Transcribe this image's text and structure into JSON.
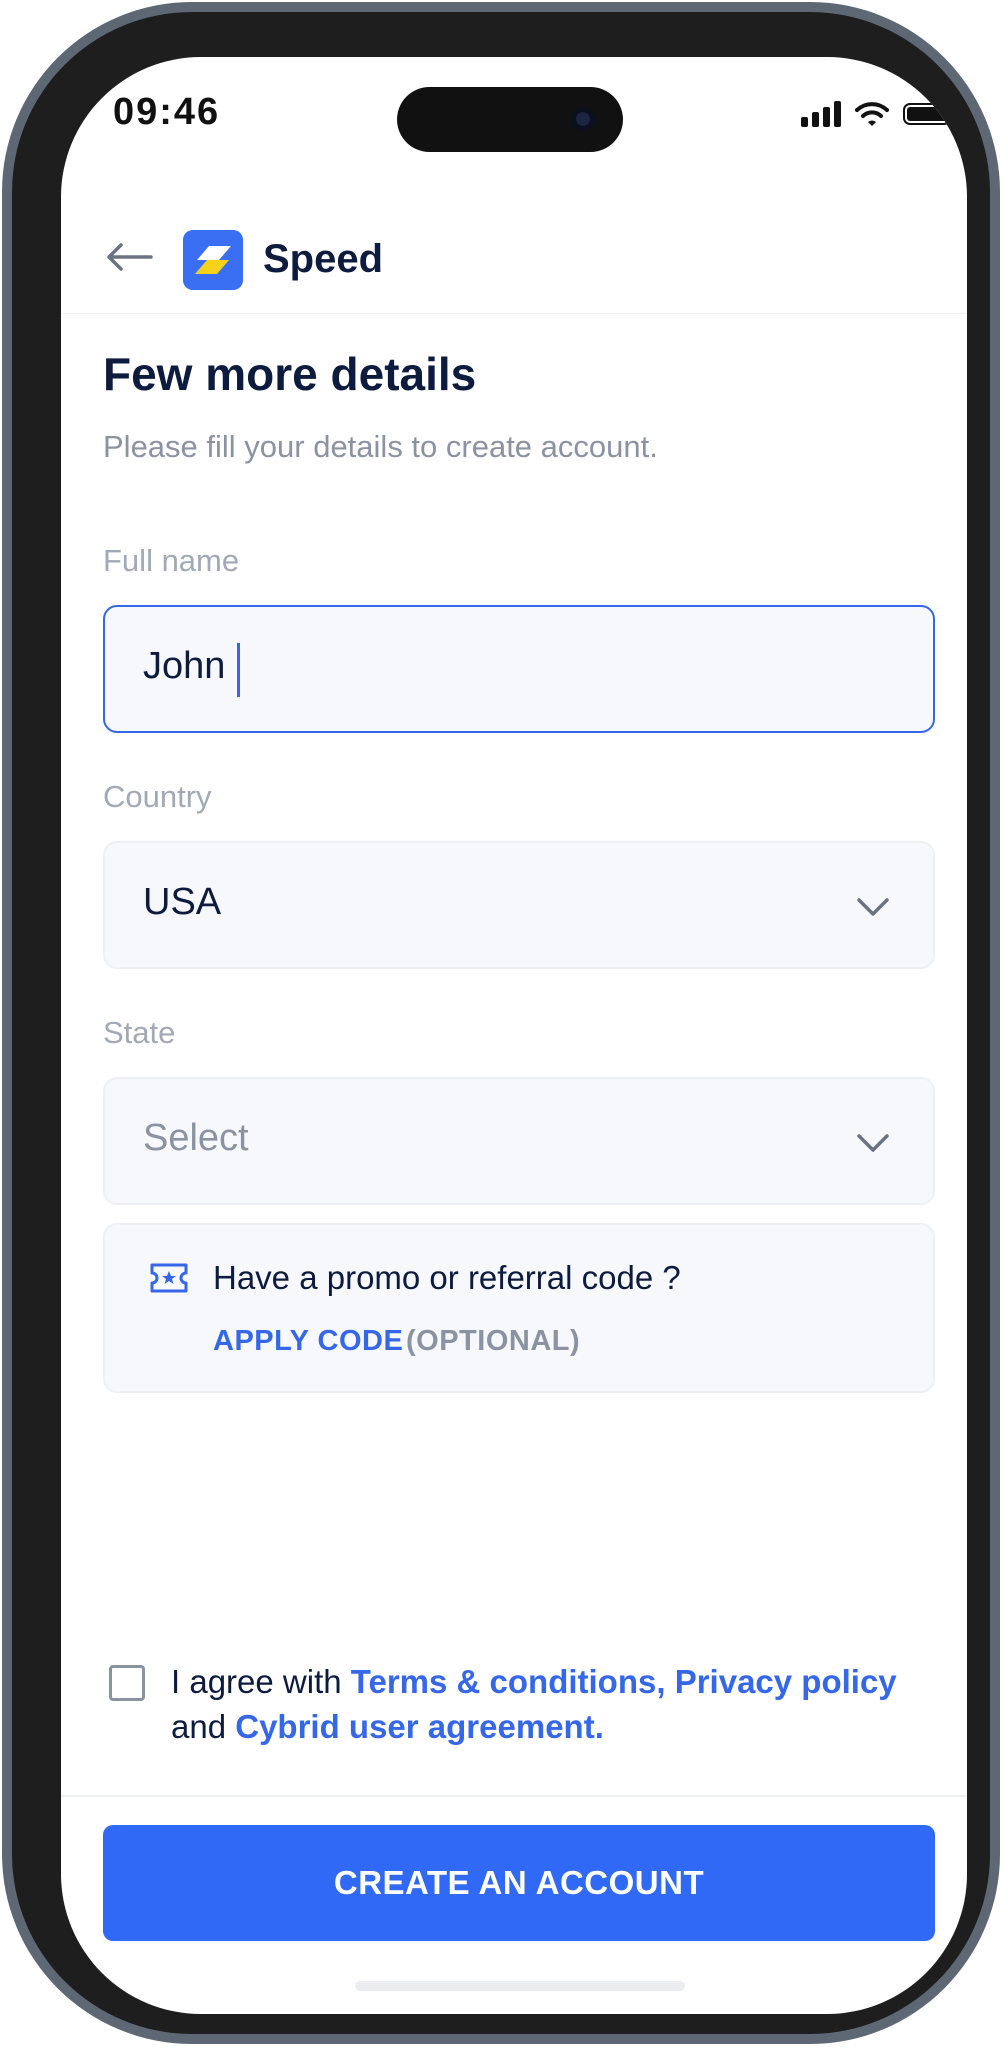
{
  "status_bar": {
    "time": "09:46"
  },
  "header": {
    "brand": "Speed"
  },
  "page": {
    "title": "Few more details",
    "subtitle": "Please fill your details to create account."
  },
  "form": {
    "full_name": {
      "label": "Full name",
      "value": "John"
    },
    "country": {
      "label": "Country",
      "value": "USA"
    },
    "state": {
      "label": "State",
      "placeholder": "Select"
    }
  },
  "promo": {
    "text": "Have a promo or referral code ?",
    "apply_label": "APPLY CODE",
    "optional_label": "(OPTIONAL)"
  },
  "agreement": {
    "prefix": "I agree with ",
    "terms_link": "Terms & conditions,",
    "privacy_link": "Privacy policy",
    "conjunction": " and ",
    "cybrid_link": "Cybrid user agreement.",
    "checked": false
  },
  "cta": {
    "label": "CREATE AN ACCOUNT"
  },
  "colors": {
    "accent": "#3069f6",
    "heading": "#0d1b3e",
    "muted": "#8b93a3"
  }
}
